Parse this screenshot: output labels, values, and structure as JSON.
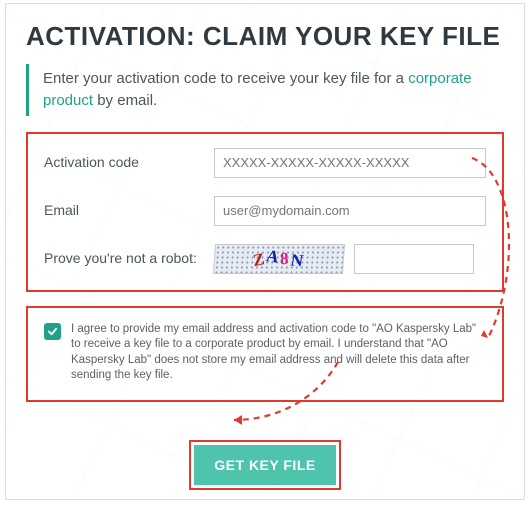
{
  "title": "ACTIVATION: CLAIM YOUR KEY FILE",
  "intro": {
    "text_before": "Enter your activation code to receive your key file for a ",
    "link_text": "corporate product",
    "text_after": " by email."
  },
  "form": {
    "activation": {
      "label": "Activation code",
      "placeholder": "XXXXX-XXXXX-XXXXX-XXXXX",
      "value": ""
    },
    "email": {
      "label": "Email",
      "placeholder": "user@mydomain.com",
      "value": ""
    },
    "captcha": {
      "label": "Prove you're not a robot:",
      "image_text": "ZA8N",
      "value": ""
    }
  },
  "agreement": {
    "checked": true,
    "text": "I agree to provide my email address and activation code to \"AO Kaspersky Lab\" to receive a key file to a corporate product by email. I understand that \"AO Kaspersky Lab\" does not store my email address and will delete this data after sending the key file."
  },
  "button": {
    "label": "GET KEY FILE"
  },
  "colors": {
    "accent": "#1ea28a",
    "highlight": "#e03a2f",
    "button": "#4fc4ad"
  }
}
